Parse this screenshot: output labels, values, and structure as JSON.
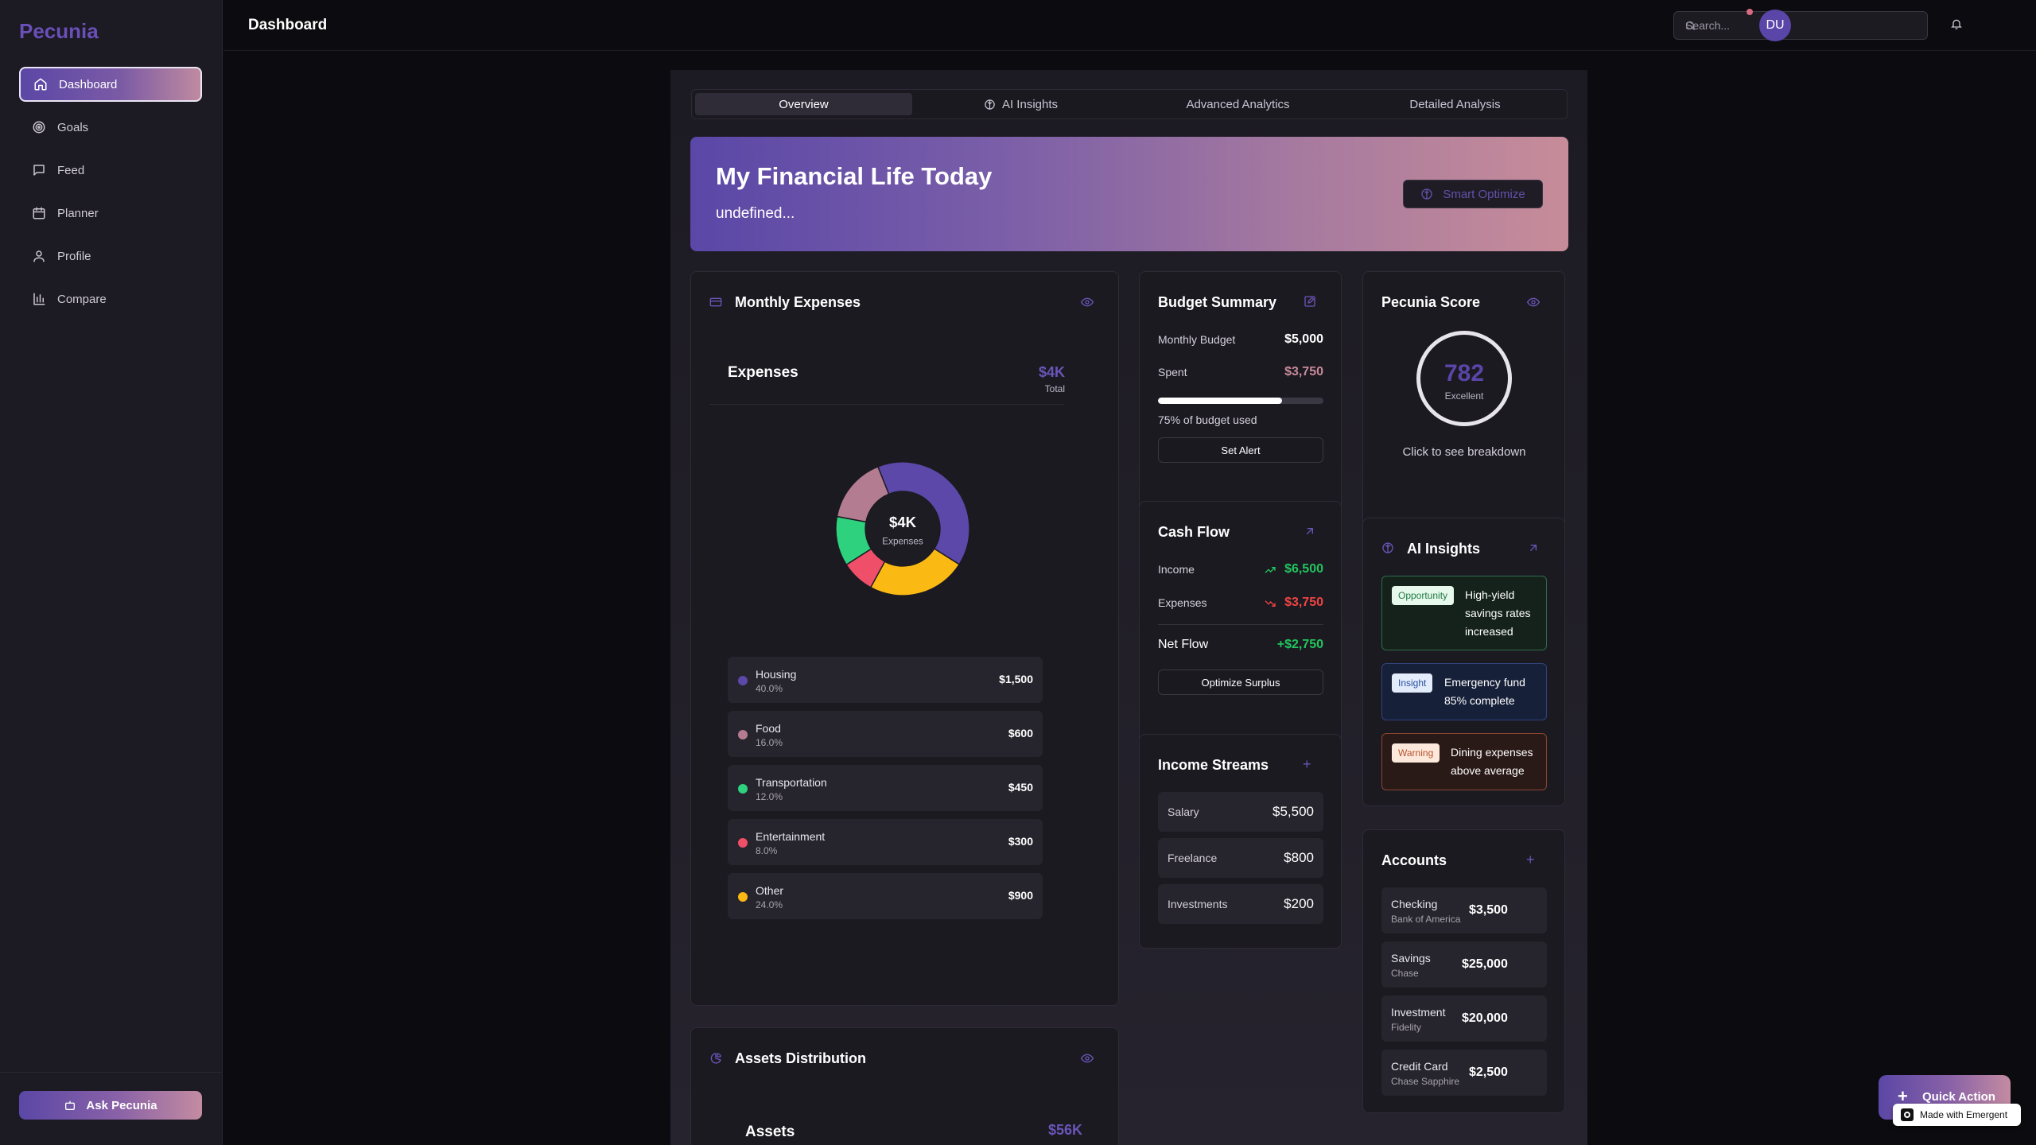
{
  "sidebar": {
    "brand": "Pecunia",
    "items": [
      {
        "label": "Dashboard",
        "icon": "home-icon"
      },
      {
        "label": "Goals",
        "icon": "target-icon"
      },
      {
        "label": "Feed",
        "icon": "message-icon"
      },
      {
        "label": "Planner",
        "icon": "calendar-icon"
      },
      {
        "label": "Profile",
        "icon": "user-icon"
      },
      {
        "label": "Compare",
        "icon": "bar-chart-icon"
      }
    ],
    "active_item": "Dashboard",
    "ask_button": "Ask Pecunia"
  },
  "header": {
    "title": "Dashboard",
    "search_placeholder": "Search...",
    "avatar_initials": "DU"
  },
  "tabs": [
    {
      "label": "Overview",
      "active": true
    },
    {
      "label": "AI Insights",
      "active": false
    },
    {
      "label": "Advanced Analytics",
      "active": false
    },
    {
      "label": "Detailed Analysis",
      "active": false
    }
  ],
  "hero": {
    "title": "My Financial Life Today",
    "subtitle": "undefined...",
    "button": "Smart Optimize"
  },
  "monthly_expenses": {
    "title": "Monthly Expenses",
    "inner_title": "Expenses",
    "total_value": "$4K",
    "total_label": "Total",
    "center_value": "$4K",
    "center_label": "Expenses",
    "categories": [
      {
        "name": "Housing",
        "pct": "40.0%",
        "amount": "$1,500",
        "color": "#5b48a8"
      },
      {
        "name": "Food",
        "pct": "16.0%",
        "amount": "$600",
        "color": "#b47c90"
      },
      {
        "name": "Transportation",
        "pct": "12.0%",
        "amount": "$450",
        "color": "#2dd17e"
      },
      {
        "name": "Entertainment",
        "pct": "8.0%",
        "amount": "$300",
        "color": "#ef4f68"
      },
      {
        "name": "Other",
        "pct": "24.0%",
        "amount": "$900",
        "color": "#fbb914"
      }
    ]
  },
  "chart_data": {
    "type": "pie",
    "categories": [
      "Housing",
      "Food",
      "Transportation",
      "Entertainment",
      "Other"
    ],
    "values": [
      1500,
      600,
      450,
      300,
      900
    ],
    "colors": [
      "#5b48a8",
      "#b47c90",
      "#2dd17e",
      "#ef4f68",
      "#fbb914"
    ]
  },
  "budget": {
    "title": "Budget Summary",
    "monthly_label": "Monthly Budget",
    "monthly_value": "$5,000",
    "spent_label": "Spent",
    "spent_value": "$3,750",
    "used_fraction": 0.75,
    "used_text": "75% of budget used",
    "button": "Set Alert"
  },
  "cash_flow": {
    "title": "Cash Flow",
    "income_label": "Income",
    "income_value": "$6,500",
    "expenses_label": "Expenses",
    "expenses_value": "$3,750",
    "net_label": "Net Flow",
    "net_value": "+$2,750",
    "button": "Optimize Surplus"
  },
  "income_streams": {
    "title": "Income Streams",
    "items": [
      {
        "name": "Salary",
        "value": "$5,500"
      },
      {
        "name": "Freelance",
        "value": "$800"
      },
      {
        "name": "Investments",
        "value": "$200"
      }
    ]
  },
  "score": {
    "title": "Pecunia Score",
    "value": "782",
    "rating": "Excellent",
    "hint": "Click to see breakdown"
  },
  "ai_insights": {
    "title": "AI Insights",
    "items": [
      {
        "badge": "Opportunity",
        "text": "High-yield savings rates increased"
      },
      {
        "badge": "Insight",
        "text": "Emergency fund 85% complete"
      },
      {
        "badge": "Warning",
        "text": "Dining expenses above average"
      }
    ]
  },
  "accounts": {
    "title": "Accounts",
    "items": [
      {
        "name": "Checking",
        "institution": "Bank of America",
        "value": "$3,500"
      },
      {
        "name": "Savings",
        "institution": "Chase",
        "value": "$25,000"
      },
      {
        "name": "Investment",
        "institution": "Fidelity",
        "value": "$20,000"
      },
      {
        "name": "Credit Card",
        "institution": "Chase Sapphire",
        "value": "$2,500"
      }
    ]
  },
  "assets": {
    "title": "Assets Distribution",
    "inner_title": "Assets",
    "total_value": "$56K"
  },
  "quick_action": "Quick Action",
  "made_with": "Made with Emergent",
  "colors": {
    "accent": "#5b48a8",
    "positive": "#22c55e",
    "negative": "#ef4444",
    "spent": "#c98a9a"
  }
}
